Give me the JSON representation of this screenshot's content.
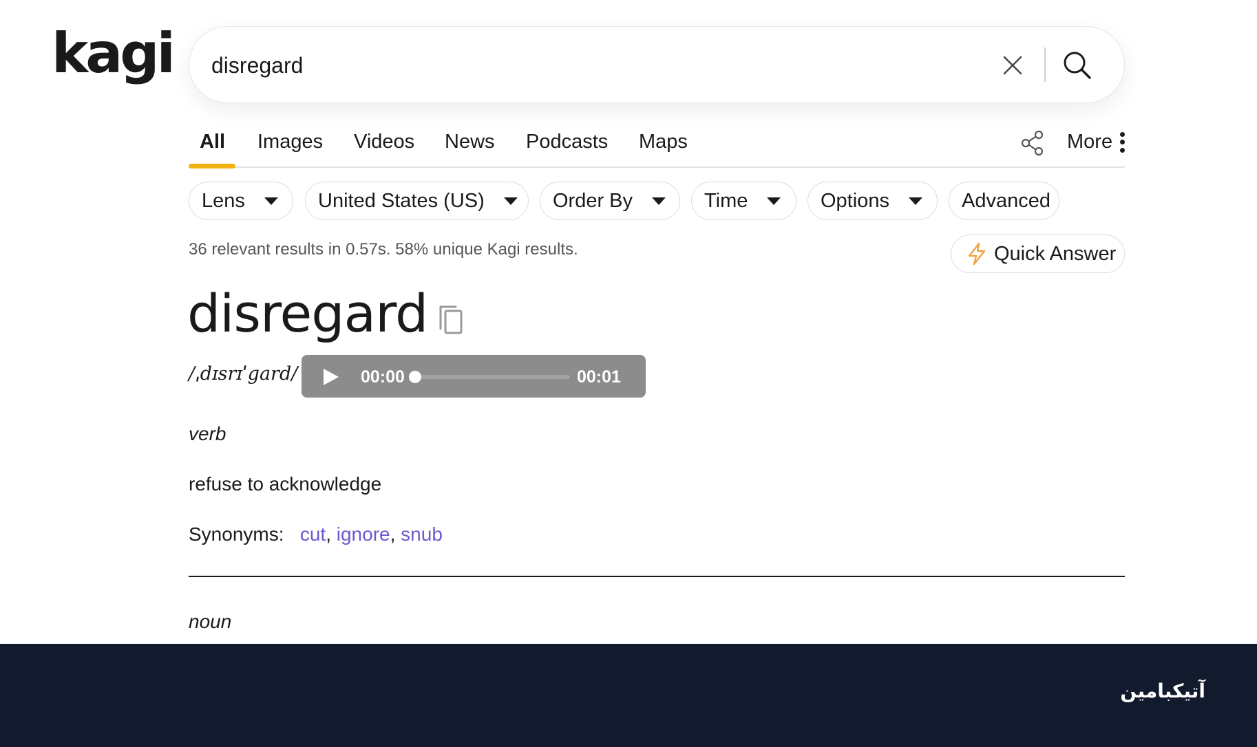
{
  "logo": {
    "text": "kagi"
  },
  "search": {
    "query": "disregard"
  },
  "tabs": [
    {
      "label": "All"
    },
    {
      "label": "Images"
    },
    {
      "label": "Videos"
    },
    {
      "label": "News"
    },
    {
      "label": "Podcasts"
    },
    {
      "label": "Maps"
    }
  ],
  "more_label": "More",
  "filters": {
    "lens": "Lens",
    "region": "United States (US)",
    "order_by": "Order By",
    "time": "Time",
    "options": "Options",
    "advanced": "Advanced"
  },
  "results_meta": "36 relevant results in 0.57s. 58% unique Kagi results.",
  "quick_answer_label": "Quick Answer",
  "dictionary": {
    "word": "disregard",
    "phonetic": "/ˌdɪsrɪˈgard/",
    "audio": {
      "current": "00:00",
      "total": "00:01",
      "progress": 0
    },
    "verb": {
      "pos": "verb",
      "definition": "refuse to acknowledge",
      "synonyms_label": "Synonyms:",
      "synonyms": [
        "cut",
        "ignore",
        "snub"
      ]
    },
    "noun": {
      "pos": "noun"
    }
  },
  "watermark": "آتیکبامین",
  "colors": {
    "accent_underline": "#f2b20f",
    "link": "#6a5bcf",
    "footer_bg": "#121a2d",
    "audio_bg": "#8c8c8c",
    "bolt": "#f0a340"
  }
}
